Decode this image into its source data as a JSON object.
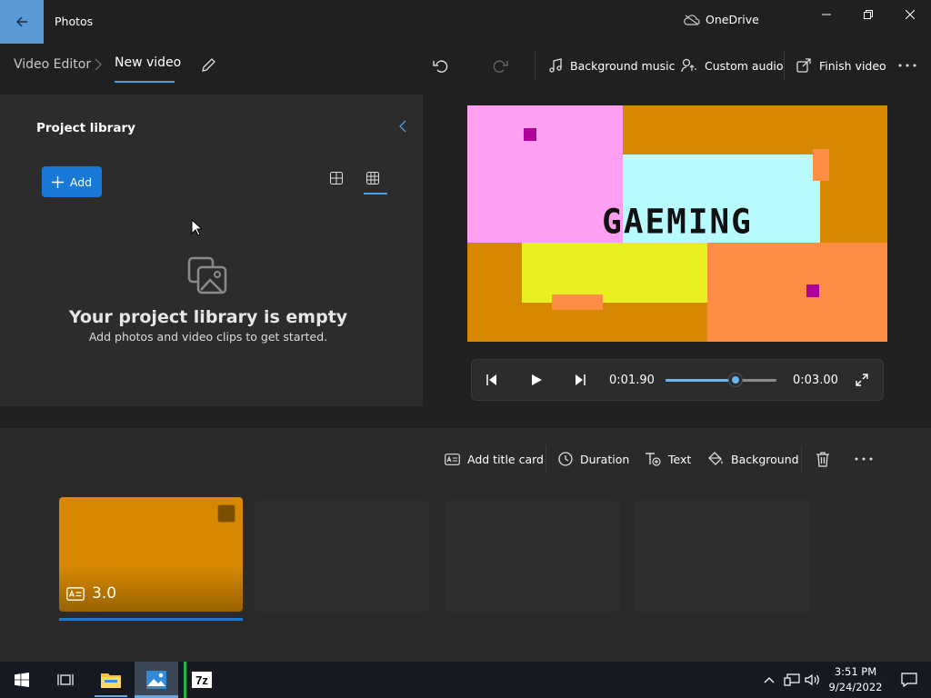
{
  "window": {
    "app_title": "Photos",
    "onedrive_label": "OneDrive"
  },
  "toolbar": {
    "breadcrumb_root": "Video Editor",
    "breadcrumb_current": "New video",
    "background_music_label": "Background music",
    "custom_audio_label": "Custom audio",
    "finish_video_label": "Finish video"
  },
  "library": {
    "title": "Project library",
    "add_label": "Add",
    "empty_title": "Your project library is empty",
    "empty_subtitle": "Add photos and video clips to get started."
  },
  "preview": {
    "overlay_text": "GAEMING"
  },
  "playback": {
    "current_time": "0:01.90",
    "total_time": "0:03.00",
    "progress": 0.633
  },
  "storyboard": {
    "add_title_card_label": "Add title card",
    "duration_label": "Duration",
    "text_label": "Text",
    "background_label": "Background",
    "clips": [
      {
        "duration": "3.0"
      }
    ]
  },
  "taskbar": {
    "time": "3:51 PM",
    "date": "9/24/2022",
    "sevenzip_label": "7z"
  },
  "colors": {
    "accent": "#1a78d6",
    "clip_color": "#d68900"
  }
}
